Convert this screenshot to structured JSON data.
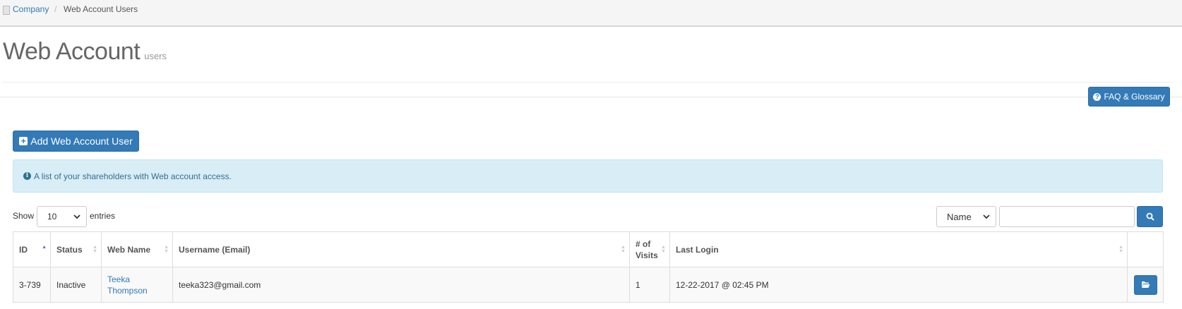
{
  "breadcrumb": {
    "company": "Company",
    "separator": "/",
    "current": "Web Account Users"
  },
  "page": {
    "title": "Web Account",
    "subtitle": "users"
  },
  "faq_button": {
    "label": "FAQ & Glossary",
    "icon": "question-circle-icon"
  },
  "add_button": {
    "label": "Add Web Account User",
    "icon": "plus-square-icon"
  },
  "alert": {
    "text": "A list of your shareholders with Web account access.",
    "icon": "info-circle-icon"
  },
  "length_menu": {
    "show_label": "Show",
    "selected": "10",
    "entries_label": "entries"
  },
  "search": {
    "field_selected": "Name",
    "value": "",
    "button_icon": "search-icon"
  },
  "table": {
    "columns": [
      {
        "label": "ID",
        "sort": "asc"
      },
      {
        "label": "Status",
        "sort": "both"
      },
      {
        "label": "Web Name",
        "sort": "both"
      },
      {
        "label": "Username (Email)",
        "sort": "both"
      },
      {
        "label": "# of Visits",
        "sort": "both"
      },
      {
        "label": "Last Login",
        "sort": "both"
      },
      {
        "label": "",
        "sort": "none"
      }
    ],
    "rows": [
      {
        "id": "3-739",
        "status": "Inactive",
        "web_name": "Teeka Thompson",
        "email": "teeka323@gmail.com",
        "visits": "1",
        "last_login": "12-22-2017 @ 02:45 PM",
        "action_icon": "folder-open-icon"
      }
    ]
  },
  "colors": {
    "primary": "#337ab7",
    "inactive": "#ff0000",
    "alert_bg": "#d9edf7",
    "alert_text": "#31708f",
    "sort_active": "#5b6fc8"
  }
}
